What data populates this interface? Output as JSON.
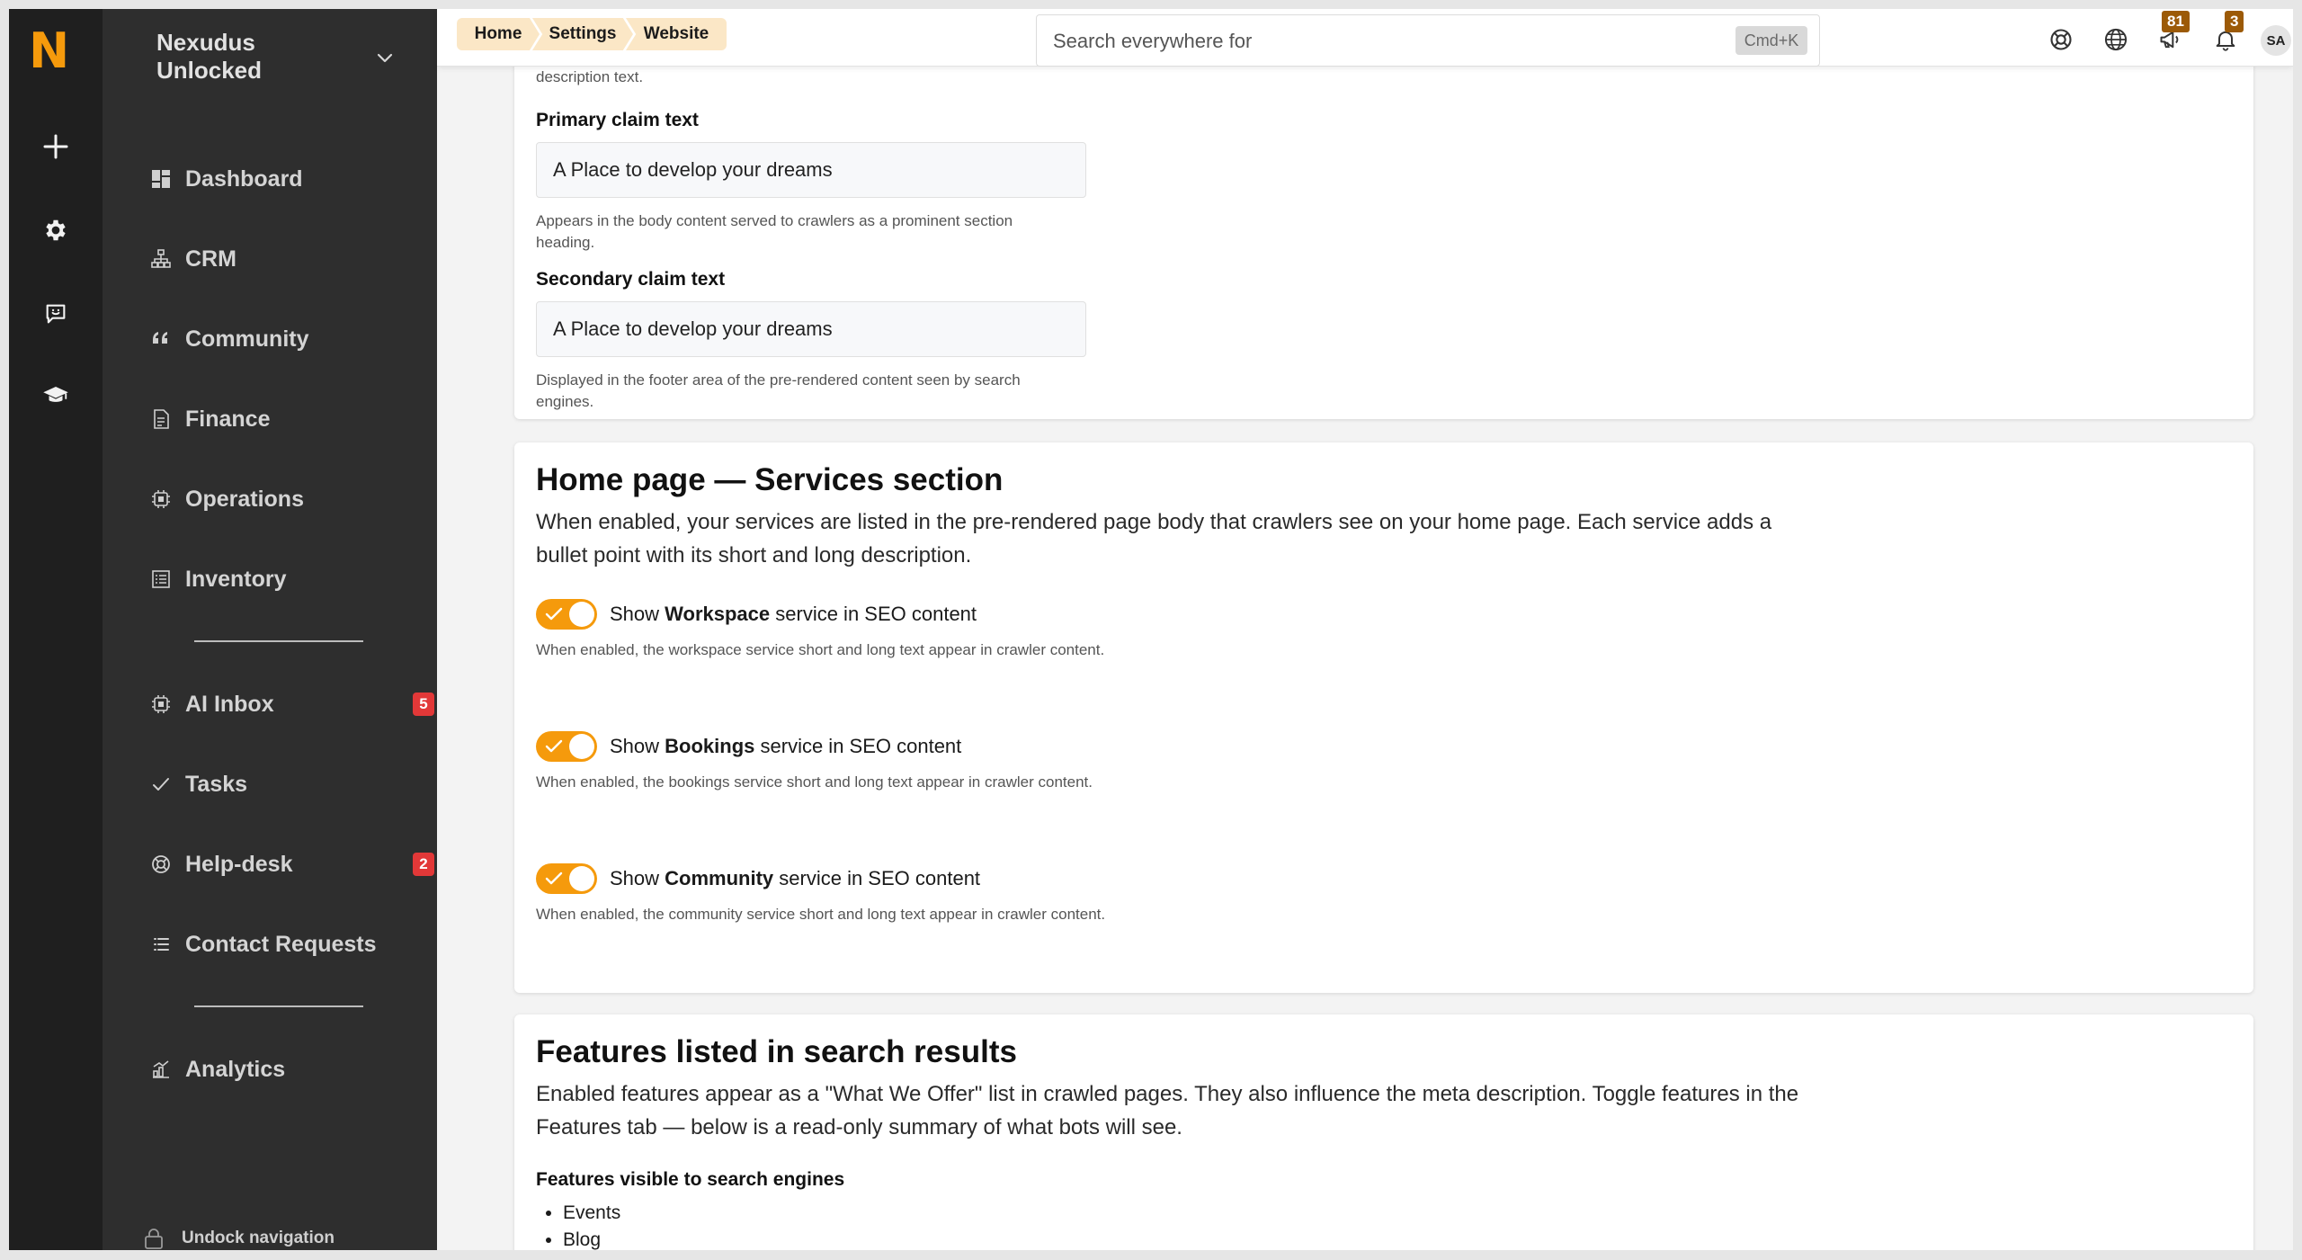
{
  "rail": {
    "logo": "N"
  },
  "sidebar": {
    "org_name": "Nexudus Unlocked",
    "items": [
      {
        "label": "Dashboard",
        "icon": "dashboard-icon"
      },
      {
        "label": "CRM",
        "icon": "sitemap-icon"
      },
      {
        "label": "Community",
        "icon": "quote-icon"
      },
      {
        "label": "Finance",
        "icon": "document-icon"
      },
      {
        "label": "Operations",
        "icon": "chip-icon"
      },
      {
        "label": "Inventory",
        "icon": "list-icon"
      },
      {
        "label": "AI Inbox",
        "icon": "chip-icon",
        "badge": "5"
      },
      {
        "label": "Tasks",
        "icon": "check-icon"
      },
      {
        "label": "Help-desk",
        "icon": "lifebuoy-icon",
        "badge": "2"
      },
      {
        "label": "Contact Requests",
        "icon": "list-icon"
      },
      {
        "label": "Analytics",
        "icon": "chart-icon"
      }
    ],
    "undock_label": "Undock navigation"
  },
  "topbar": {
    "breadcrumbs": [
      "Home",
      "Settings",
      "Website"
    ],
    "search_placeholder": "Search everywhere for",
    "search_shortcut": "Cmd+K",
    "announcements_count": "81",
    "notifications_count": "3",
    "avatar_initials": "SA"
  },
  "seo_texts": {
    "partial_help": "description text.",
    "primary_claim_label": "Primary claim text",
    "primary_claim_value": "A Place to develop your dreams",
    "primary_claim_help": "Appears in the body content served to crawlers as a prominent section heading.",
    "secondary_claim_label": "Secondary claim text",
    "secondary_claim_value": "A Place to develop your dreams",
    "secondary_claim_help": "Displayed in the footer area of the pre-rendered content seen by search engines."
  },
  "services_section": {
    "title": "Home page — Services section",
    "description": "When enabled, your services are listed in the pre-rendered page body that crawlers see on your home page. Each service adds a bullet point with its short and long description.",
    "toggles": [
      {
        "prefix": "Show ",
        "name": "Workspace",
        "suffix": " service in SEO content",
        "enabled": true,
        "help": "When enabled, the workspace service short and long text appear in crawler content."
      },
      {
        "prefix": "Show ",
        "name": "Bookings",
        "suffix": " service in SEO content",
        "enabled": true,
        "help": "When enabled, the bookings service short and long text appear in crawler content."
      },
      {
        "prefix": "Show ",
        "name": "Community",
        "suffix": " service in SEO content",
        "enabled": true,
        "help": "When enabled, the community service short and long text appear in crawler content."
      }
    ]
  },
  "features_section": {
    "title": "Features listed in search results",
    "description": "Enabled features appear as a \"What We Offer\" list in crawled pages. They also influence the meta description. Toggle features in the Features tab — below is a read-only summary of what bots will see.",
    "list_label": "Features visible to search engines",
    "features": [
      "Events",
      "Blog"
    ]
  },
  "colors": {
    "accent": "#f59a0c",
    "rail_bg": "#1f1f1f",
    "sidebar_bg": "#2e2e2e",
    "badge_red": "#e23838",
    "crumb_bg": "#fbe7c6"
  }
}
